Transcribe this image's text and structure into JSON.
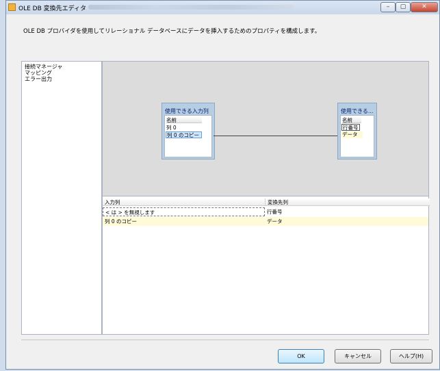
{
  "window": {
    "title": "OLE DB 変換先エディタ",
    "buttons": {
      "minimize": "–",
      "maximize": "▢",
      "close": "✕"
    }
  },
  "description": "OLE DB プロバイダを使用してリレーショナル データベースにデータを挿入するためのプロパティを構成します。",
  "nav": {
    "items": [
      {
        "label": "接続マネージャ"
      },
      {
        "label": "マッピング"
      },
      {
        "label": "エラー出力"
      }
    ]
  },
  "mapping": {
    "input_table": {
      "title": "使用できる入力列",
      "column_header": "名前",
      "columns": [
        "列 0",
        "列 0 のコピー"
      ]
    },
    "output_table": {
      "title": "使用できる...",
      "column_header": "名前",
      "columns": [
        "行番号",
        "データ"
      ]
    }
  },
  "grid": {
    "headers": [
      "入力列",
      "変換先列"
    ],
    "rows": [
      [
        "< は > を無視します",
        "行番号"
      ],
      [
        "列 0 のコピー",
        "データ"
      ]
    ]
  },
  "buttons": {
    "ok": "OK",
    "cancel": "キャンセル",
    "help": "ヘルプ(H)"
  },
  "colors": {
    "selected_row": "#fffbd9",
    "selected_col": "#cde6ff"
  }
}
